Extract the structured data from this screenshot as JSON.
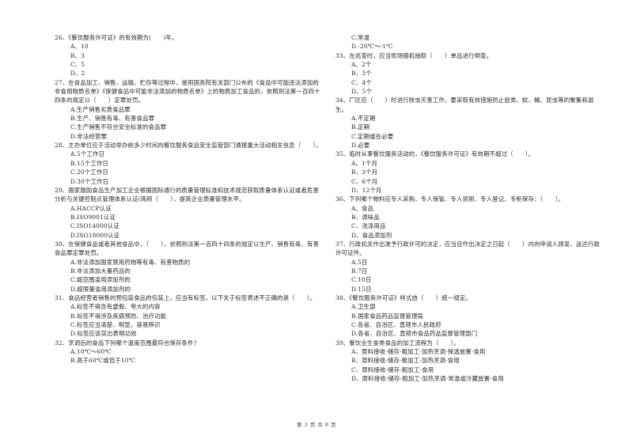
{
  "page": {
    "footer": "第 3 页 共 8 页"
  },
  "left_column": [
    {
      "type": "question",
      "text": "26、《餐饮服务许可证》的有效期为(　　)年。"
    },
    {
      "type": "option",
      "text": "A、10"
    },
    {
      "type": "option",
      "text": "B、3"
    },
    {
      "type": "option",
      "text": "C、5"
    },
    {
      "type": "option",
      "text": "D、2"
    },
    {
      "type": "question",
      "text": "27、在食品加工、销售、运输、贮存等过程中，使用国务院有关部门公布的《食品中可能违法添加的非食用物质名单》《保健食品中可能非法添加的物质名单》上的物质加工食品的，依照刑法第一百四十四条的规定以（　　）定罪处罚。"
    },
    {
      "type": "option",
      "text": "A.生产销售劣质食品罪"
    },
    {
      "type": "option",
      "text": "B.生产、销售有毒、有害食品罪"
    },
    {
      "type": "option",
      "text": "C.生产销售不符合安全标准的食品罪"
    },
    {
      "type": "option",
      "text": "D.非法经营罪"
    },
    {
      "type": "question",
      "text": "28、主办单位应于活动举办前多少时间向餐饮服务食品安全监管部门通报重大活动相关信息（　　）。"
    },
    {
      "type": "option",
      "text": "A.5个工作日"
    },
    {
      "type": "option",
      "text": "B.15个工作日"
    },
    {
      "type": "option",
      "text": "C.20个工作日"
    },
    {
      "type": "option",
      "text": "D.30个工作日"
    },
    {
      "type": "question",
      "text": "29、国家鼓励食品生产加工企业根据国际通行的质量管理标准和技术规范获取质量体系认证或者危害分析与关键控制点管理体系认证(简称（　　），提高企业质量管理水平。"
    },
    {
      "type": "option",
      "text": "A.HACCP认证"
    },
    {
      "type": "option",
      "text": "B.ISO9001认证"
    },
    {
      "type": "option",
      "text": "C.ISO14000认证"
    },
    {
      "type": "option",
      "text": "D.ISO18000认证"
    },
    {
      "type": "question",
      "text": "30、在保健食品或者其他食品中，（　　），依照刑法第一百四十四条的规定以生产、销售有毒、有害食品罪定罪处罚。"
    },
    {
      "type": "option",
      "text": "A.非法添加国家禁用药物等有毒、有害物质的"
    },
    {
      "type": "option",
      "text": "B.非法添加大量药品的"
    },
    {
      "type": "option",
      "text": "C.超范围滥用添加剂的"
    },
    {
      "type": "option",
      "text": "D.超限量滥用添加剂的"
    },
    {
      "type": "question",
      "text": "31、食品经营者销售的预包装食品的包装上，应当有标签，以下关于标签表述不正确的是（　　）。"
    },
    {
      "type": "option",
      "text": "A.标签不得含有虚假、夸大的内容"
    },
    {
      "type": "option",
      "text": "B.标签不得涉及疾病预防、治疗功能"
    },
    {
      "type": "option",
      "text": "C.标签应当清楚、明显，容易辨识"
    },
    {
      "type": "option",
      "text": "D.标签应该突出表明功效"
    },
    {
      "type": "question",
      "text": "32、烹调后的食品下列哪个温度范围最符合保存条件?"
    },
    {
      "type": "option",
      "text": "A.10℃～60℃"
    },
    {
      "type": "option",
      "text": "B.高于60℃或低于10℃"
    }
  ],
  "right_column": [
    {
      "type": "option",
      "text": "C.常温"
    },
    {
      "type": "option",
      "text": "D.-20℃～-1℃"
    },
    {
      "type": "question",
      "text": "33、在巡查时，应当现场随机抽取（　　）单品进行倒查。"
    },
    {
      "type": "option",
      "text": "A、2个"
    },
    {
      "type": "option",
      "text": "B、3个"
    },
    {
      "type": "option",
      "text": "C、4个"
    },
    {
      "type": "option",
      "text": "D、5个"
    },
    {
      "type": "question",
      "text": "34、厂区应（　　）时进行除虫灭害工作，要采取有效措施防止鼠类、蚊、蝇、昆虫等的聚集和滋生。"
    },
    {
      "type": "option",
      "text": "A.不定期"
    },
    {
      "type": "option",
      "text": "B.定期"
    },
    {
      "type": "option",
      "text": "C.定期或在必要"
    },
    {
      "type": "option",
      "text": "D.必要"
    },
    {
      "type": "question",
      "text": "35、临时从事餐饮服务活动的，《餐饮服务许可证》有效期不超过（　　）。"
    },
    {
      "type": "option",
      "text": "A、1个月"
    },
    {
      "type": "option",
      "text": "B、3个月"
    },
    {
      "type": "option",
      "text": "C、6个月"
    },
    {
      "type": "option",
      "text": "D、12个月"
    },
    {
      "type": "question",
      "text": "36、下列哪个物料应专人采购、专人保管、专人领用、专人登记、专柜保存：（　　）。"
    },
    {
      "type": "option",
      "text": "A、食品"
    },
    {
      "type": "option",
      "text": "B、调味品"
    },
    {
      "type": "option",
      "text": "C、洗涤用品"
    },
    {
      "type": "option",
      "text": "D、食品添加剂"
    },
    {
      "type": "question",
      "text": "37、行政机关作出准予行政许可的决定，应当自作出决定之日起（　　）内向申请人颁发、送达行政许可证件。"
    },
    {
      "type": "option",
      "text": "A.5日"
    },
    {
      "type": "option",
      "text": "B.7日"
    },
    {
      "type": "option",
      "text": "C.10日"
    },
    {
      "type": "option",
      "text": "D.15日"
    },
    {
      "type": "question",
      "text": "38、《餐饮服务许可证》样式由（　　）统一规定。"
    },
    {
      "type": "option",
      "text": "A.卫生部"
    },
    {
      "type": "option",
      "text": "B.国家食品药品监督管理局"
    },
    {
      "type": "option",
      "text": "C.各省、自治区、直辖市人民政府"
    },
    {
      "type": "option",
      "text": "D.各省、自治区、直辖市食品药品监督管理部门"
    },
    {
      "type": "question",
      "text": "39、餐饮业生食类食品的加工流程为（　　）。"
    },
    {
      "type": "option",
      "text": "A、原料接收-储存-粗加工-加热烹调-保温放置-食用"
    },
    {
      "type": "option",
      "text": "B、原料接收-储存-粗加工-加热烹调-食用"
    },
    {
      "type": "option",
      "text": "C、原料接收-储存-粗加工-食用"
    },
    {
      "type": "option",
      "text": "D、原料接收-储存-粗加工-加热烹调-常温或冷藏放置-食用"
    }
  ]
}
